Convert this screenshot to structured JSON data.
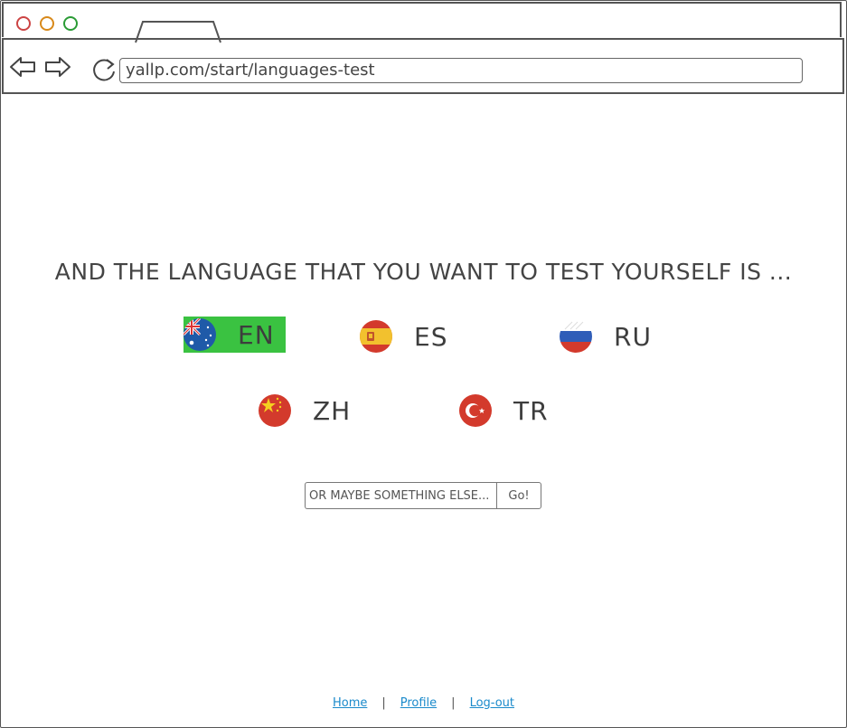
{
  "browser": {
    "url": "yallp.com/start/languages-test"
  },
  "page": {
    "heading": "AND THE LANGUAGE THAT YOU WANT TO TEST YOURSELF IS ...",
    "languages": [
      {
        "code": "EN",
        "flag": "australia-flag-icon",
        "selected": true
      },
      {
        "code": "ES",
        "flag": "spain-flag-icon",
        "selected": false
      },
      {
        "code": "RU",
        "flag": "russia-flag-icon",
        "selected": false
      },
      {
        "code": "ZH",
        "flag": "china-flag-icon",
        "selected": false
      },
      {
        "code": "TR",
        "flag": "turkey-flag-icon",
        "selected": false
      }
    ],
    "other": {
      "placeholder": "OR MAYBE SOMETHING ELSE...",
      "go_label": "Go!"
    }
  },
  "footer": {
    "links": [
      "Home",
      "Profile",
      "Log-out"
    ],
    "separator": "|"
  },
  "colors": {
    "selected_bg": "#3ac241",
    "link": "#1a8acb"
  }
}
